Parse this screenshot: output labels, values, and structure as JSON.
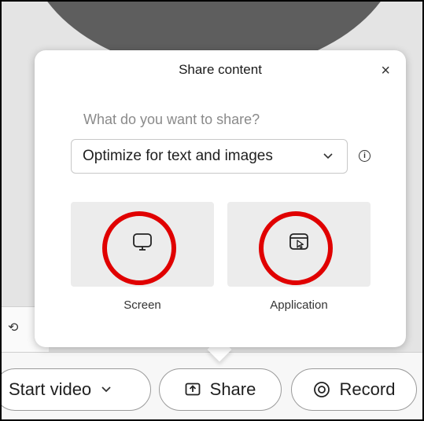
{
  "dialog": {
    "title": "Share content",
    "close_icon": "close-icon",
    "question": "What do you want to share?",
    "optimize_select": {
      "value": "Optimize for text and images",
      "icon": "chevron-down-icon"
    },
    "info_icon": "info-icon",
    "options": [
      {
        "label": "Screen",
        "icon": "monitor-icon"
      },
      {
        "label": "Application",
        "icon": "application-window-icon"
      }
    ],
    "highlight_color": "#e00000"
  },
  "toolbar": {
    "start_video_label": "Start video",
    "share_label": "Share",
    "record_label": "Record"
  }
}
